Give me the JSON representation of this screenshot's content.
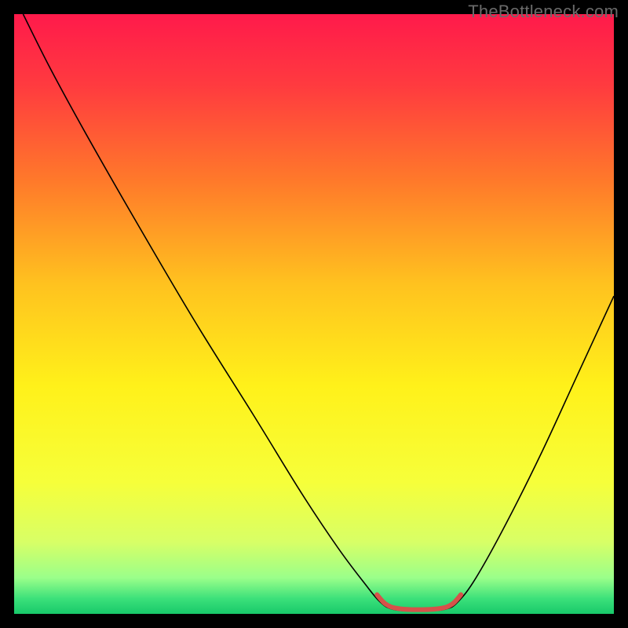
{
  "watermark": "TheBottleneck.com",
  "chart_data": {
    "type": "line",
    "title": "",
    "xlabel": "",
    "ylabel": "",
    "xlim": [
      0,
      100
    ],
    "ylim": [
      0,
      100
    ],
    "background_gradient": {
      "stops": [
        {
          "offset": 0.0,
          "color": "#ff1a4b"
        },
        {
          "offset": 0.12,
          "color": "#ff3b3f"
        },
        {
          "offset": 0.28,
          "color": "#ff7a2a"
        },
        {
          "offset": 0.45,
          "color": "#ffc21f"
        },
        {
          "offset": 0.62,
          "color": "#fff11a"
        },
        {
          "offset": 0.78,
          "color": "#f6ff3a"
        },
        {
          "offset": 0.88,
          "color": "#d8ff66"
        },
        {
          "offset": 0.94,
          "color": "#9aff8a"
        },
        {
          "offset": 0.975,
          "color": "#3be07a"
        },
        {
          "offset": 1.0,
          "color": "#18c96a"
        }
      ]
    },
    "series": [
      {
        "name": "bottleneck-curve",
        "color": "#000000",
        "width": 1.6,
        "points": [
          {
            "x": 1.5,
            "y": 100.0
          },
          {
            "x": 6.0,
            "y": 91.0
          },
          {
            "x": 12.0,
            "y": 80.0
          },
          {
            "x": 20.0,
            "y": 66.0
          },
          {
            "x": 30.0,
            "y": 49.0
          },
          {
            "x": 40.0,
            "y": 33.0
          },
          {
            "x": 48.0,
            "y": 20.0
          },
          {
            "x": 54.0,
            "y": 11.0
          },
          {
            "x": 58.5,
            "y": 5.0
          },
          {
            "x": 61.0,
            "y": 2.0
          },
          {
            "x": 63.0,
            "y": 0.8
          },
          {
            "x": 66.0,
            "y": 0.5
          },
          {
            "x": 69.0,
            "y": 0.5
          },
          {
            "x": 72.0,
            "y": 0.8
          },
          {
            "x": 74.0,
            "y": 2.0
          },
          {
            "x": 77.0,
            "y": 6.0
          },
          {
            "x": 82.0,
            "y": 15.0
          },
          {
            "x": 88.0,
            "y": 27.0
          },
          {
            "x": 94.0,
            "y": 40.0
          },
          {
            "x": 100.0,
            "y": 53.0
          }
        ]
      },
      {
        "name": "optimal-zone",
        "color": "#d6524a",
        "width": 6.0,
        "cap": "round",
        "points": [
          {
            "x": 60.5,
            "y": 3.2
          },
          {
            "x": 62.0,
            "y": 1.6
          },
          {
            "x": 64.0,
            "y": 0.9
          },
          {
            "x": 67.5,
            "y": 0.7
          },
          {
            "x": 71.0,
            "y": 0.9
          },
          {
            "x": 73.0,
            "y": 1.6
          },
          {
            "x": 74.5,
            "y": 3.2
          }
        ]
      }
    ]
  }
}
